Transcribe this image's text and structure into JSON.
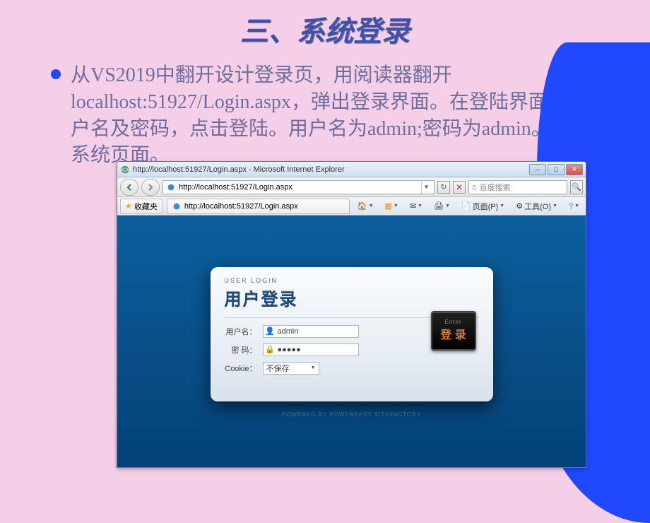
{
  "slide": {
    "title": "三、系统登录",
    "body": "从VS2019中翻开设计登录页，用阅读器翻开localhost:51927/Login.aspx，弹出登录界面。在登陆界面输入用户名及密码，点击登陆。用户名为admin;密码为admin。进入系统页面。"
  },
  "browser": {
    "window_title": "http://localhost:51927/Login.aspx - Microsoft Internet Explorer",
    "url": "http://localhost:51927/Login.aspx",
    "tab_url": "http://localhost:51927/Login.aspx",
    "search_placeholder": "百度搜索",
    "toolbar": {
      "favorites": "收藏夹",
      "page": "页面(P)",
      "tools": "工具(O)"
    }
  },
  "login": {
    "sub": "user Login",
    "main": "用户登录",
    "labels": {
      "username": "用户名：",
      "password": "密 码：",
      "cookie": "Cookie："
    },
    "values": {
      "username": "admin",
      "password": "●●●●●",
      "cookie": "不保存"
    },
    "button": {
      "enter": "Enter",
      "login": "登 录"
    },
    "footer": "POWERED BY POWEREASY SITEFACTORY"
  }
}
